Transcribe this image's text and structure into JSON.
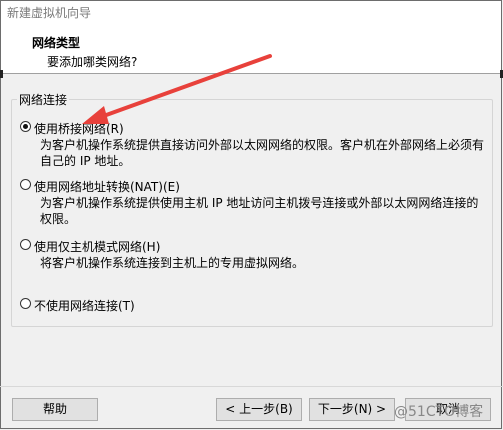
{
  "window": {
    "title": "新建虚拟机向导"
  },
  "header": {
    "title": "网络类型",
    "subtitle": "要添加哪类网络?"
  },
  "group": {
    "label": "网络连接"
  },
  "options": [
    {
      "label": "使用桥接网络(R)",
      "description": "为客户机操作系统提供直接访问外部以太网网络的权限。客户机在外部网络上必须有自己的 IP 地址。",
      "selected": true
    },
    {
      "label": "使用网络地址转换(NAT)(E)",
      "description": "为客户机操作系统提供使用主机 IP 地址访问主机拨号连接或外部以太网网络连接的权限。",
      "selected": false
    },
    {
      "label": "使用仅主机模式网络(H)",
      "description": "将客户机操作系统连接到主机上的专用虚拟网络。",
      "selected": false
    },
    {
      "label": "不使用网络连接(T)",
      "description": "",
      "selected": false
    }
  ],
  "buttons": {
    "help": "帮助",
    "back": "< 上一步(B)",
    "next": "下一步(N) >",
    "cancel": "取消"
  },
  "watermark": "@51CTO博客",
  "colors": {
    "arrow": "#e8413b"
  }
}
